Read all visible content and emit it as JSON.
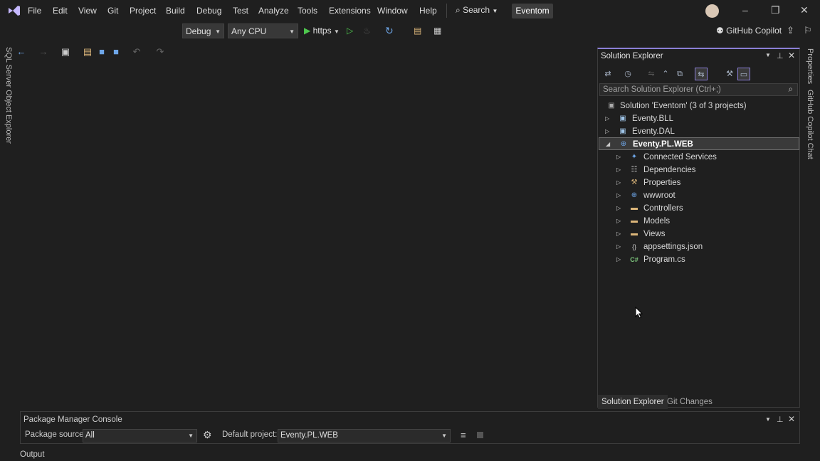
{
  "menubar": {
    "items": [
      "File",
      "Edit",
      "View",
      "Git",
      "Project",
      "Build",
      "Debug",
      "Test",
      "Analyze",
      "Tools",
      "Extensions",
      "Window",
      "Help"
    ],
    "search_label": "Search",
    "solution_name": "Eventom",
    "copilot_label": "GitHub Copilot"
  },
  "toolbar": {
    "configuration": "Debug",
    "platform": "Any CPU",
    "run_target": "https"
  },
  "side_tabs": {
    "left": "SQL Server Object Explorer",
    "right_properties": "Properties",
    "right_copilot_chat": "GitHub Copilot Chat"
  },
  "solution_explorer": {
    "title": "Solution Explorer",
    "search_placeholder": "Search Solution Explorer (Ctrl+;)",
    "solution_label": "Solution 'Eventom' (3 of 3 projects)",
    "projects": [
      "Eventy.BLL",
      "Eventy.DAL",
      "Eventy.PL.WEB"
    ],
    "web_children": [
      "Connected Services",
      "Dependencies",
      "Properties",
      "wwwroot",
      "Controllers",
      "Models",
      "Views",
      "appsettings.json",
      "Program.cs"
    ],
    "bottom_tabs": [
      "Solution Explorer",
      "Git Changes"
    ]
  },
  "package_manager": {
    "title": "Package Manager Console",
    "source_label": "Package source:",
    "source_value": "All",
    "default_project_label": "Default project:",
    "default_project_value": "Eventy.PL.WEB"
  },
  "output_label": "Output",
  "colors": {
    "accent": "#8b7fd6",
    "background": "#1f1f1f",
    "run_green": "#4ec94e"
  },
  "icons": [
    "vs-logo-icon",
    "search-icon",
    "back-icon",
    "forward-icon",
    "new-project-icon",
    "open-icon",
    "save-icon",
    "save-all-icon",
    "undo-icon",
    "redo-icon",
    "play-icon",
    "play-outline-icon",
    "refresh-icon",
    "copilot-icon",
    "pin-icon",
    "close-icon",
    "gear-icon",
    "clear-icon",
    "stop-icon"
  ]
}
